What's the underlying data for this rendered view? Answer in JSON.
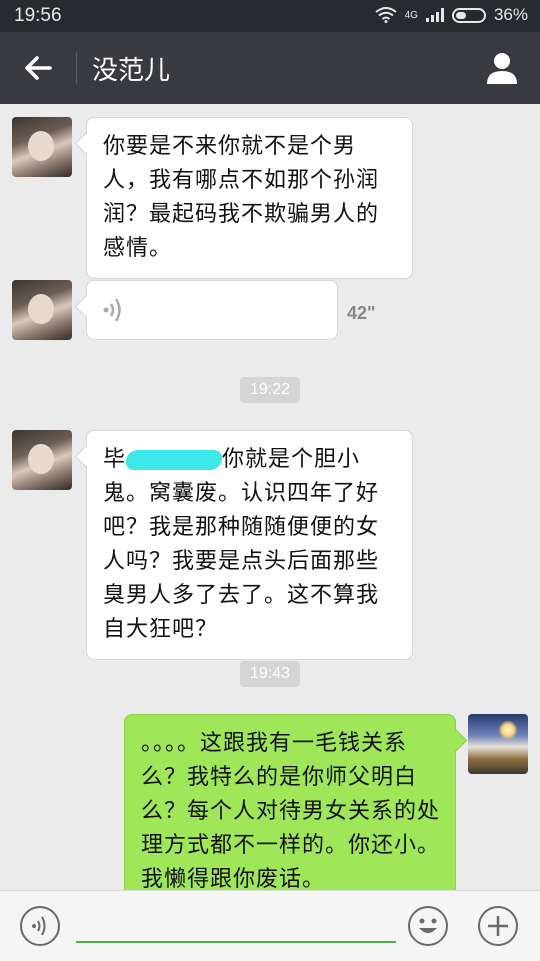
{
  "status": {
    "time": "19:56",
    "network": "4G",
    "battery_text": "36%"
  },
  "header": {
    "title": "没范儿",
    "back_icon": "arrow-left-icon",
    "profile_icon": "person-icon"
  },
  "messages": [
    {
      "type": "text",
      "side": "left",
      "text": "你要是不来你就不是个男人，我有哪点不如那个孙润润？最起码我不欺骗男人的感情。"
    },
    {
      "type": "voice",
      "side": "left",
      "duration": "42\""
    },
    {
      "type": "time",
      "text": "19:22"
    },
    {
      "type": "text",
      "side": "left",
      "prefix": "毕",
      "text": "你就是个胆小鬼。窝囊废。认识四年了好吧？我是那种随随便便的女人吗？我要是点头后面那些臭男人多了去了。这不算我自大狂吧？"
    },
    {
      "type": "time",
      "text": "19:43"
    },
    {
      "type": "text",
      "side": "right",
      "text": "。。。。这跟我有一毛钱关系么？我特么的是你师父明白么？每个人对待男女关系的处理方式都不一样的。你还小。我懒得跟你废话。"
    }
  ],
  "colors": {
    "accent": "#9fe658",
    "header": "#393a3f"
  },
  "input": {
    "voice_icon": "voice-icon",
    "emoji_icon": "emoji-icon",
    "add_icon": "plus-icon"
  }
}
